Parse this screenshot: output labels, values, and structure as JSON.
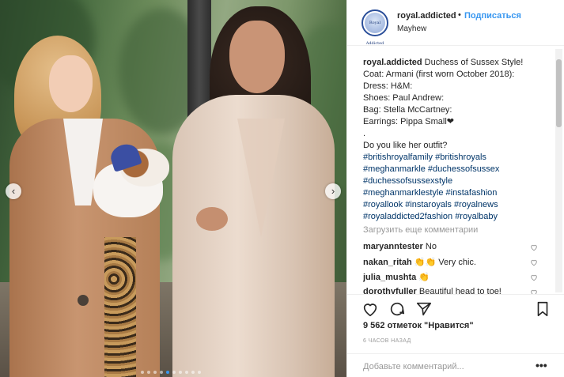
{
  "post": {
    "username": "royal.addicted",
    "bullet": "•",
    "follow_label": "Подписаться",
    "location": "Mayhew",
    "avatar_text": "Royal Addicted"
  },
  "caption": {
    "lines": [
      {
        "uname": "royal.addicted",
        "text": " Duchess of Sussex Style!"
      },
      {
        "text": "Coat: Armani (first worn October 2018):"
      },
      {
        "text": "Dress: H&M:"
      },
      {
        "text": "Shoes: Paul Andrew:"
      },
      {
        "text": "Bag: Stella McCartney:"
      },
      {
        "text": "Earrings: Pippa Small❤"
      },
      {
        "text": "."
      },
      {
        "text": "Do you like her outfit?"
      },
      {
        "tags": "#britishroyalfamily #britishroyals"
      },
      {
        "tags": "#meghanmarkle #duchessofsussex"
      },
      {
        "tags": "#duchessofsussexstyle"
      },
      {
        "tags": "#meghanmarklestyle #instafashion"
      },
      {
        "tags": "#royallook #instaroyals #royalnews"
      },
      {
        "tags": "#royaladdicted2fashion #royalbaby"
      }
    ]
  },
  "load_more_label": "Загрузить еще комментарии",
  "comments": [
    {
      "user": "maryanntester",
      "text": " No"
    },
    {
      "user": "nakan_ritah",
      "text": " 👏👏 Very chic."
    },
    {
      "user": "julia_mushta",
      "text": " 👏"
    },
    {
      "user": "dorothyfuller",
      "text": " Beautiful head to toe!"
    }
  ],
  "likes": "9 562 отметок \"Нравится\"",
  "time": "6 ЧАСОВ НАЗАД",
  "add_comment_placeholder": "Добавьте комментарий...",
  "more_label": "•••",
  "nav": {
    "prev": "‹",
    "next": "›"
  },
  "carousel": {
    "count": 10,
    "active_index": 4
  },
  "colors": {
    "link": "#3897f0",
    "hashtag": "#003569",
    "muted": "#999999"
  }
}
